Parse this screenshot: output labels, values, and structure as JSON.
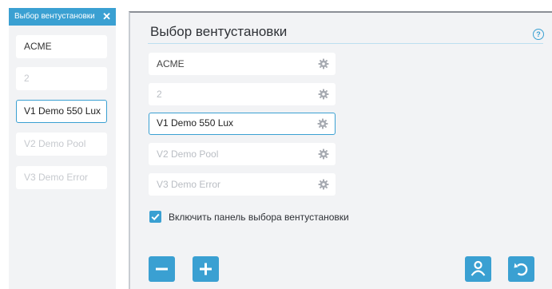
{
  "sidebar": {
    "title": "Выбор вентустановки",
    "close_glyph": "✕",
    "items": [
      {
        "label": "ACME",
        "state": "normal"
      },
      {
        "label": "2",
        "state": "dim"
      },
      {
        "label": "V1 Demo 550 Lux",
        "state": "selected"
      },
      {
        "label": "V2 Demo Pool",
        "state": "dim"
      },
      {
        "label": "V3 Demo Error",
        "state": "dim"
      }
    ]
  },
  "main": {
    "title": "Выбор вентустановки",
    "help_glyph": "?",
    "rows": [
      {
        "label": "ACME",
        "state": "normal"
      },
      {
        "label": "2",
        "state": "dim"
      },
      {
        "label": "V1 Demo 550 Lux",
        "state": "selected"
      },
      {
        "label": "V2 Demo Pool",
        "state": "dim"
      },
      {
        "label": "V3 Demo Error",
        "state": "dim"
      }
    ],
    "checkbox": {
      "label": "Включить панель выбора вентустановки",
      "checked": true
    },
    "buttons": [
      "minus-icon",
      "plus-icon",
      "user-icon",
      "undo-icon"
    ]
  },
  "colors": {
    "accent": "#3aa0d2",
    "panel": "#f2f3f5",
    "dim_text": "#b9bdc3"
  }
}
